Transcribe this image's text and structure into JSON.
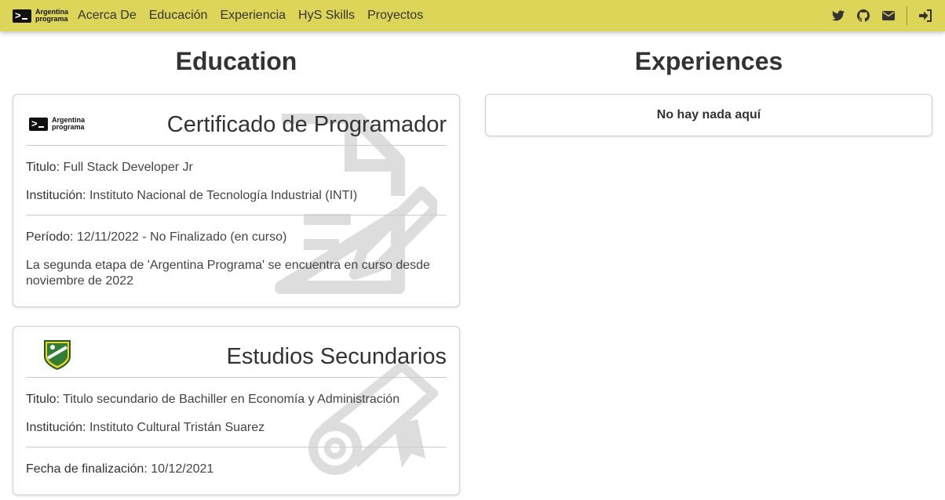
{
  "navbar": {
    "brand": {
      "line1": "Argentina",
      "line2": "programa"
    },
    "links": [
      "Acerca De",
      "Educación",
      "Experiencia",
      "HyS Skills",
      "Proyectos"
    ],
    "icons": [
      "twitter-icon",
      "github-icon",
      "envelope-icon",
      "sign-in-icon"
    ],
    "accent_color": "#ddd558"
  },
  "education": {
    "title": "Education",
    "items": [
      {
        "logo": {
          "line1": "Argentina",
          "line2": "programa"
        },
        "title": "Certificado de Programador",
        "titulo_label": "Titulo:",
        "titulo_value": "Full Stack Developer Jr",
        "institucion_label": "Institución:",
        "institucion_value": "Instituto Nacional de Tecnología Industrial (INTI)",
        "periodo_label": "Período:",
        "periodo_value": "12/11/2022 - No Finalizado (en curso)",
        "description": "La segunda etapa de 'Argentina Programa' se encuentra en curso desde noviembre de 2022",
        "watermark_icon": "document-pen-icon"
      },
      {
        "logo": "school-crest-icon",
        "title": "Estudios Secundarios",
        "titulo_label": "Titulo:",
        "titulo_value": "Titulo secundario de Bachiller en Economía y Administración",
        "institucion_label": "Institución:",
        "institucion_value": "Instituto Cultural Tristán Suarez",
        "fecha_label": "Fecha de finalización:",
        "fecha_value": "10/12/2021",
        "watermark_icon": "diploma-scroll-icon"
      }
    ]
  },
  "experiences": {
    "title": "Experiences",
    "empty_text": "No hay nada aquí"
  }
}
